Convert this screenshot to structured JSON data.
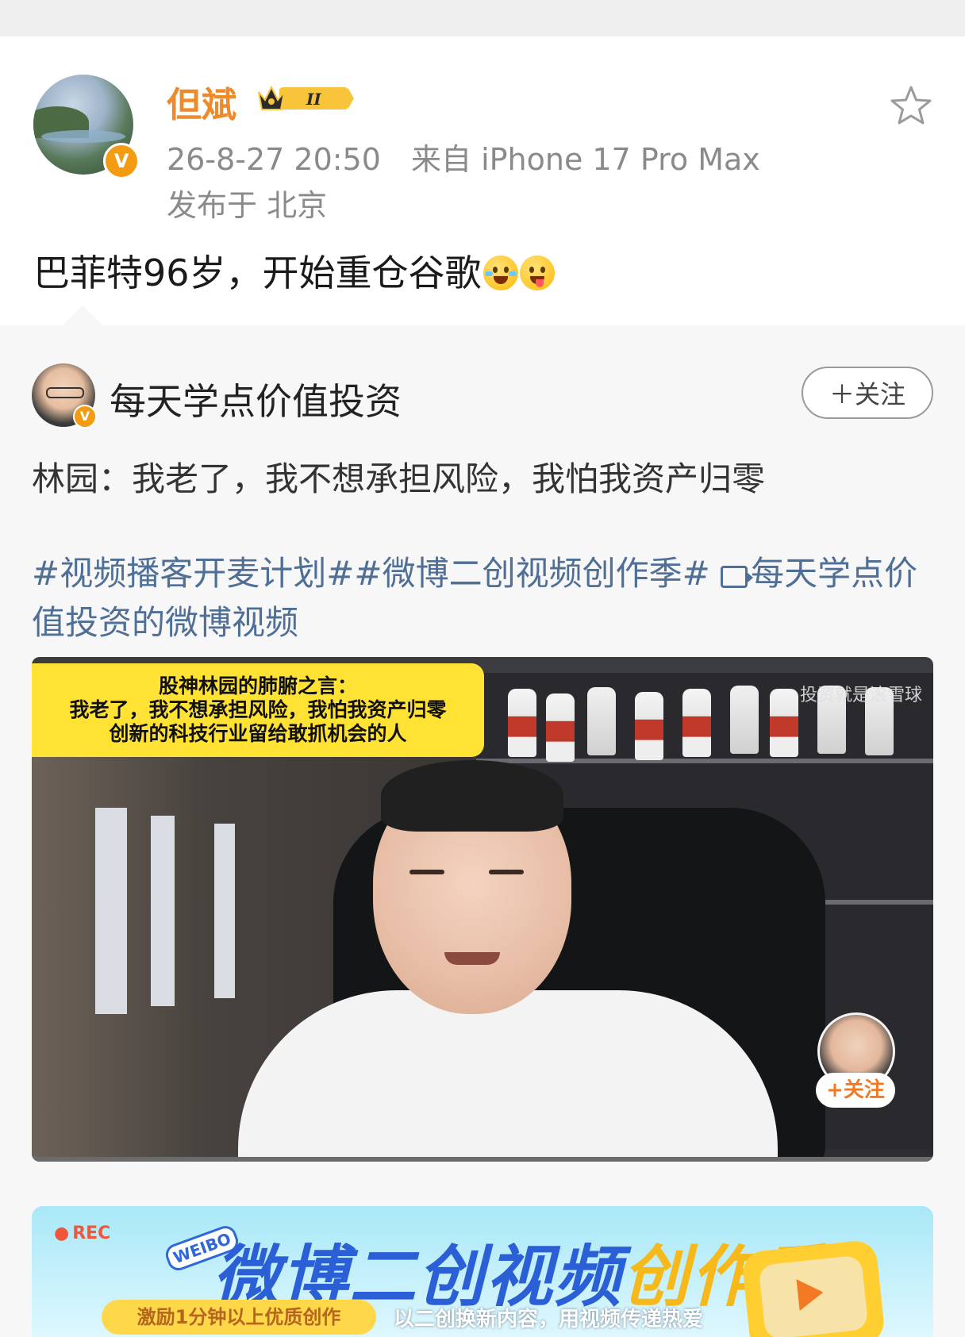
{
  "post": {
    "username": "但斌",
    "vip_level": "II",
    "timestamp": "26-8-27 20:50",
    "source": "来自 iPhone 17 Pro Max",
    "location": "发布于 北京",
    "text": "巴菲特96岁，开始重仓谷歌",
    "verified_mark": "V",
    "emojis": [
      "laughing-crying-emoji",
      "tongue-out-emoji"
    ]
  },
  "repost": {
    "author": "每天学点价值投资",
    "follow_label": "＋关注",
    "verified_mark": "V",
    "text": "林园：我老了，我不想承担风险，我怕我资产归零",
    "topics": {
      "topic1": "#视频播客开麦计划#",
      "topic2": "#微博二创视频创作季#",
      "video_link": "每天学点价值投资的微博视频"
    }
  },
  "video": {
    "caption_line1": "股神林园的肺腑之言：",
    "caption_line2": "我老了，我不想承担风险，我怕我资产归零",
    "caption_line3": "创新的科技行业留给敢抓机会的人",
    "watermark": "投资就是滚雪球",
    "mini_follow": "+关注"
  },
  "banner": {
    "rec": "REC",
    "weibo_tag": "WEIBO",
    "title_main": "微博二创视频",
    "title_accent": "创作季",
    "pill": "激励1分钟以上优质创作",
    "subtitle": "以二创换新内容，用视频传递热爱"
  },
  "colors": {
    "username": "#ee8a2a",
    "link_blue": "#4f6f96",
    "meta_gray": "#8a8a8a",
    "verified": "#f39c12",
    "caption_yellow": "#ffe234"
  }
}
